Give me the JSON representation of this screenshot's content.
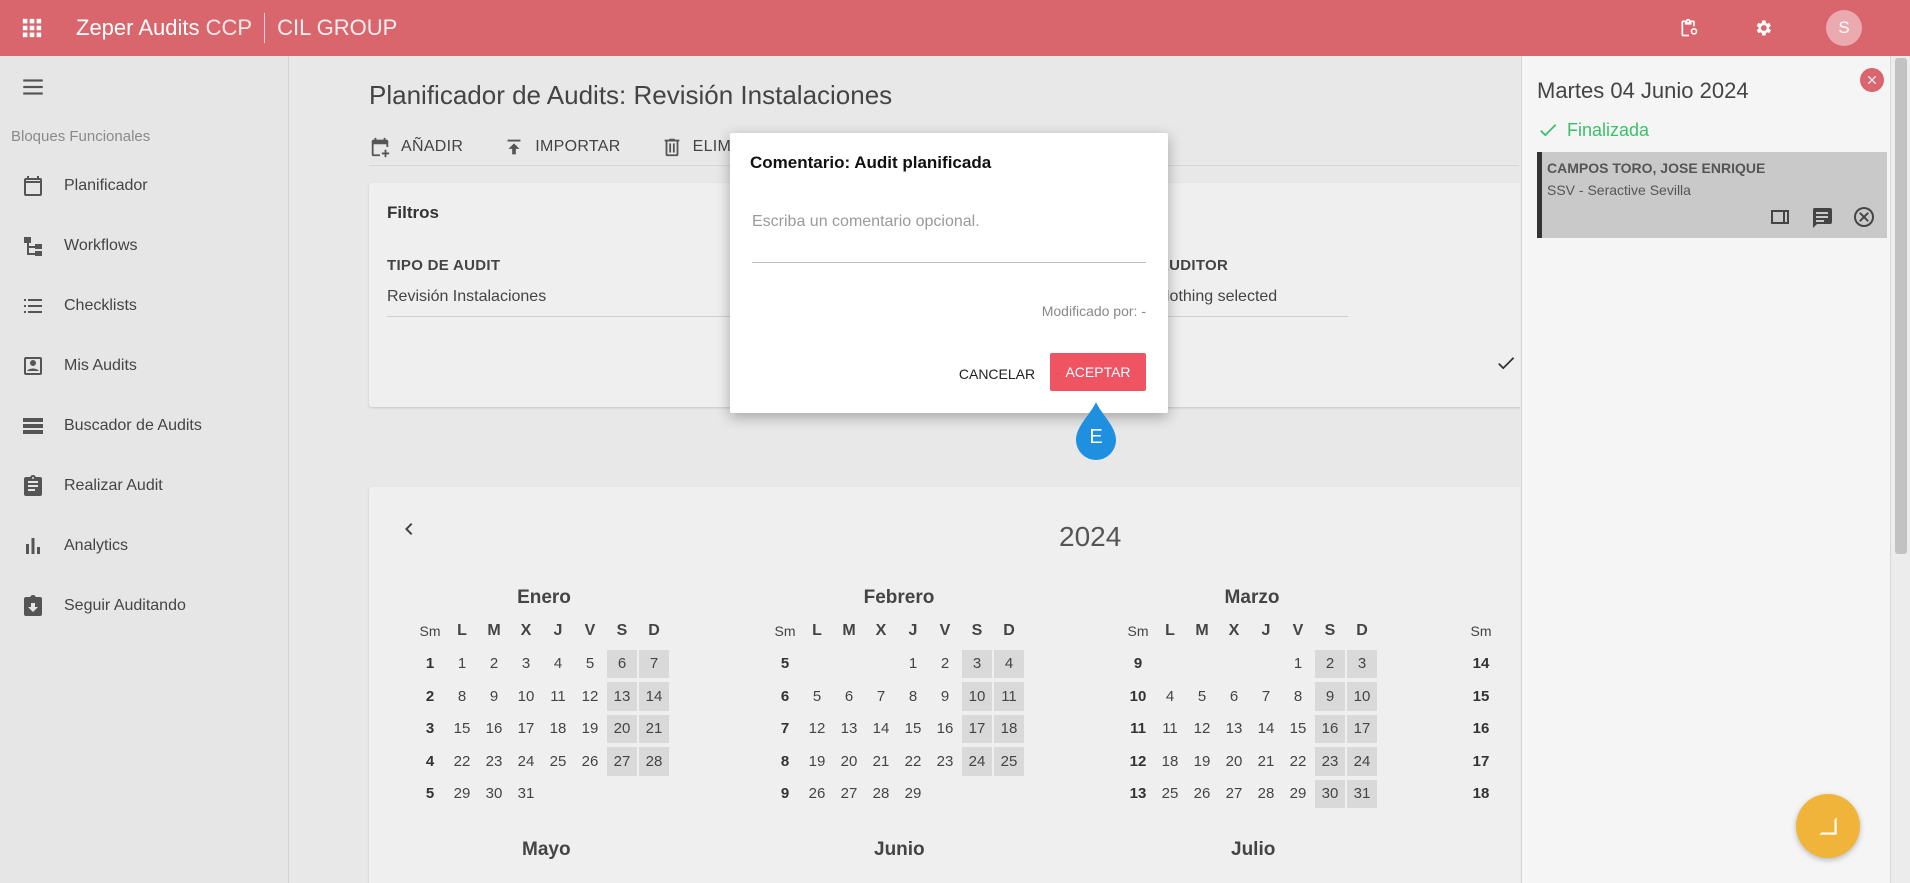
{
  "app": {
    "brand_bold": "Zeper Audits",
    "brand_light": "CCP",
    "company": "CIL GROUP",
    "avatar_initial": "S"
  },
  "sidebar": {
    "section_title": "Bloques Funcionales",
    "items": [
      {
        "label": "Planificador",
        "icon": "calendar-icon"
      },
      {
        "label": "Workflows",
        "icon": "workflow-icon"
      },
      {
        "label": "Checklists",
        "icon": "checklist-icon"
      },
      {
        "label": "Mis Audits",
        "icon": "user-card-icon"
      },
      {
        "label": "Buscador de Audits",
        "icon": "storage-icon"
      },
      {
        "label": "Realizar Audit",
        "icon": "clipboard-icon"
      },
      {
        "label": "Analytics",
        "icon": "bar-chart-icon"
      },
      {
        "label": "Seguir Auditando",
        "icon": "download-box-icon"
      }
    ]
  },
  "main": {
    "title": "Planificador de Audits: Revisión Instalaciones",
    "toolbar": {
      "add": "AÑADIR",
      "import": "IMPORTAR",
      "delete": "ELIM"
    },
    "filters": {
      "title": "Filtros",
      "tipo_label": "TIPO DE AUDIT",
      "tipo_value": "Revisión Instalaciones",
      "auditor_label": "AUDITOR",
      "auditor_value": "Nothing selected"
    },
    "calendar": {
      "year": "2024",
      "header": [
        "Sm",
        "L",
        "M",
        "X",
        "J",
        "V",
        "S",
        "D"
      ],
      "months": [
        {
          "name": "Enero",
          "weeks": [
            [
              "1",
              "1",
              "2",
              "3",
              "4",
              "5",
              "6",
              "7"
            ],
            [
              "2",
              "8",
              "9",
              "10",
              "11",
              "12",
              "13",
              "14"
            ],
            [
              "3",
              "15",
              "16",
              "17",
              "18",
              "19",
              "20",
              "21"
            ],
            [
              "4",
              "22",
              "23",
              "24",
              "25",
              "26",
              "27",
              "28"
            ],
            [
              "5",
              "29",
              "30",
              "31",
              "",
              "",
              "",
              ""
            ]
          ]
        },
        {
          "name": "Febrero",
          "weeks": [
            [
              "5",
              "",
              "",
              "",
              "1",
              "2",
              "3",
              "4"
            ],
            [
              "6",
              "5",
              "6",
              "7",
              "8",
              "9",
              "10",
              "11"
            ],
            [
              "7",
              "12",
              "13",
              "14",
              "15",
              "16",
              "17",
              "18"
            ],
            [
              "8",
              "19",
              "20",
              "21",
              "22",
              "23",
              "24",
              "25"
            ],
            [
              "9",
              "26",
              "27",
              "28",
              "29",
              "",
              "",
              ""
            ]
          ]
        },
        {
          "name": "Marzo",
          "weeks": [
            [
              "9",
              "",
              "",
              "",
              "",
              "1",
              "2",
              "3"
            ],
            [
              "10",
              "4",
              "5",
              "6",
              "7",
              "8",
              "9",
              "10"
            ],
            [
              "11",
              "11",
              "12",
              "13",
              "14",
              "15",
              "16",
              "17"
            ],
            [
              "12",
              "18",
              "19",
              "20",
              "21",
              "22",
              "23",
              "24"
            ],
            [
              "13",
              "25",
              "26",
              "27",
              "28",
              "29",
              "30",
              "31"
            ]
          ]
        },
        {
          "name": "",
          "weeks": [
            [
              "14"
            ],
            [
              "15"
            ],
            [
              "16"
            ],
            [
              "17"
            ],
            [
              "18"
            ]
          ]
        }
      ],
      "next_months": [
        "Mayo",
        "Junio",
        "Julio"
      ]
    }
  },
  "right_panel": {
    "date": "Martes 04 Junio 2024",
    "status": "Finalizada",
    "card": {
      "name": "CAMPOS TORO, JOSE ENRIQUE",
      "sub": "SSV - Seractive Sevilla"
    }
  },
  "dialog": {
    "title": "Comentario: Audit planificada",
    "placeholder": "Escriba un comentario opcional.",
    "value": "",
    "modified_by": "Modificado por: -",
    "cancel": "CANCELAR",
    "accept": "ACEPTAR"
  },
  "marker": {
    "label": "E"
  },
  "colors": {
    "topbar": "#d9656d",
    "accent": "#ef5462",
    "success": "#3cbf6b",
    "fab": "#f0b43a"
  }
}
